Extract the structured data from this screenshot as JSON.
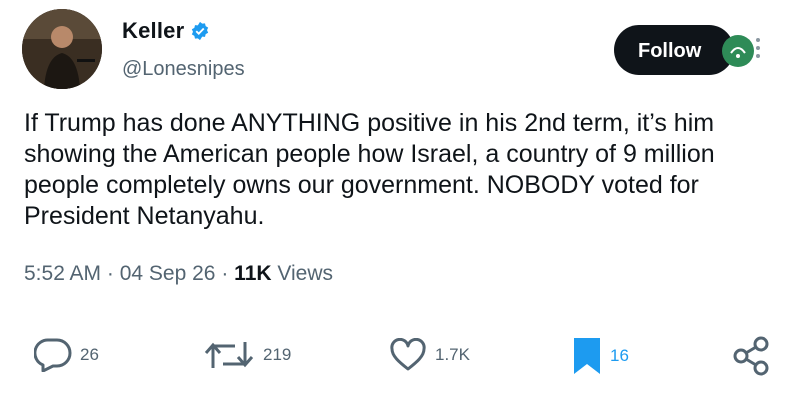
{
  "user": {
    "name": "Keller",
    "handle": "@Lonesnipes"
  },
  "follow_label": "Follow",
  "tweet": {
    "text": "If Trump has done ANYTHING positive in his 2nd term, it’s him showing the American people how Israel, a country of 9 million people completely owns our government. NOBODY voted for President Netanyahu.",
    "time": "5:52 AM",
    "date": "04 Sep 26",
    "views_count": "11K",
    "views_label": "Views"
  },
  "actions": {
    "replies": "26",
    "retweets": "219",
    "likes": "1.7K",
    "bookmarks": "16"
  },
  "colors": {
    "accent": "#1d9bf0",
    "text": "#0f1419",
    "muted": "#536471"
  },
  "icons": [
    "verified-badge-icon",
    "more-icon",
    "reply-icon",
    "retweet-icon",
    "like-icon",
    "bookmark-icon",
    "share-icon"
  ]
}
